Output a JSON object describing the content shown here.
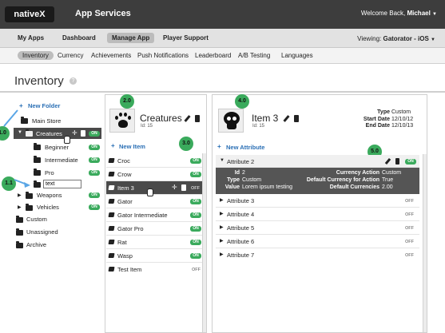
{
  "brand": {
    "logo": "nativeX",
    "app_title": "App Services",
    "welcome_prefix": "Welcome Back, ",
    "welcome_user": "Michael",
    "user_caret": "▼"
  },
  "nav_primary": [
    {
      "label": "My Apps"
    },
    {
      "label": "Dashboard"
    },
    {
      "label": "Manage App",
      "active": true
    },
    {
      "label": "Player Support"
    }
  ],
  "viewing": {
    "prefix": "Viewing: ",
    "app": "Gatorator - iOS",
    "caret": "▼"
  },
  "nav_secondary": [
    {
      "label": "Inventory",
      "active": true
    },
    {
      "label": "Currency"
    },
    {
      "label": "Achievements"
    },
    {
      "label": "Push Notifications"
    },
    {
      "label": "Leaderboard"
    },
    {
      "label": "A/B Testing"
    },
    {
      "label": "Languages"
    }
  ],
  "page": {
    "title": "Inventory",
    "help": "?"
  },
  "tree": {
    "new_folder": "New Folder",
    "plus": "+",
    "main_store": "Main Store",
    "creatures": "Creatures",
    "beginner": "Beginner",
    "intermediate": "Intermediate",
    "pro": "Pro",
    "new_input": "text",
    "weapons": "Weapons",
    "vehicles": "Vehicles",
    "custom": "Custom",
    "unassigned": "Unassigned",
    "archive": "Archive",
    "on": "ON",
    "off": "OFF",
    "expand": "▶",
    "collapse": "▼",
    "move": "✛",
    "trash": "🗑",
    "callout_10": "1.0",
    "callout_11": "1.1"
  },
  "items_panel": {
    "badge": "2.0",
    "title": "Creatures",
    "id": "Id: 15",
    "new_item": "New Item",
    "badge_list": "3.0",
    "items": [
      {
        "label": "Croc",
        "status": "ON"
      },
      {
        "label": "Crow",
        "status": "ON"
      },
      {
        "label": "Item 3",
        "status": "OFF"
      },
      {
        "label": "Gator",
        "status": "ON"
      },
      {
        "label": "Gator Intermediate",
        "status": "ON"
      },
      {
        "label": "Gator Pro",
        "status": "ON"
      },
      {
        "label": "Rat",
        "status": "ON"
      },
      {
        "label": "Wasp",
        "status": "ON"
      },
      {
        "label": "Test Item",
        "status": "OFF"
      }
    ]
  },
  "detail": {
    "badge": "4.0",
    "title": "Item 3",
    "id": "Id: 15",
    "type_key": "Type",
    "type_val": "Custom",
    "start_key": "Start Date",
    "start_val": "12/10/12",
    "end_key": "End Date",
    "end_val": "12/10/13",
    "new_attr": "New Attribute",
    "badge_attr": "5.0",
    "attr2": {
      "label": "Attribute 2",
      "status": "ON",
      "id_k": "Id",
      "id_v": "2",
      "type_k": "Type",
      "type_v": "Custom",
      "value_k": "Value",
      "value_v": "Lorem ipsum testing",
      "ca_k": "Currency Action",
      "ca_v": "Custom",
      "dc_k": "Default Currency for Action",
      "dc_v": "True",
      "dcs_k": "Default Currencies",
      "dcs_v": "2.00"
    },
    "attrs": [
      {
        "label": "Attribute 3",
        "status": "OFF"
      },
      {
        "label": "Attribute 4",
        "status": "OFF"
      },
      {
        "label": "Attribute 5",
        "status": "OFF"
      },
      {
        "label": "Attribute 6",
        "status": "OFF"
      },
      {
        "label": "Attribute 7",
        "status": "OFF"
      }
    ]
  }
}
